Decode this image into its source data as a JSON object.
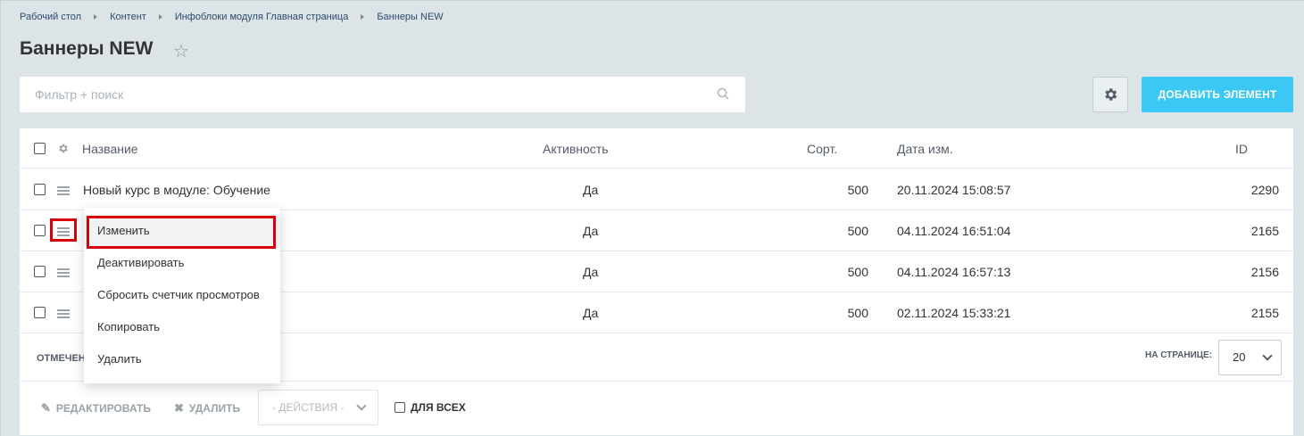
{
  "breadcrumb": [
    "Рабочий стол",
    "Контент",
    "Инфоблоки модуля Главная страница",
    "Баннеры NEW"
  ],
  "page": {
    "title": "Баннеры NEW"
  },
  "filter": {
    "placeholder": "Фильтр + поиск"
  },
  "toolbar": {
    "add_label": "ДОБАВИТЬ ЭЛЕМЕНТ"
  },
  "table": {
    "columns": {
      "name": "Название",
      "active": "Активность",
      "sort": "Сорт.",
      "date": "Дата изм.",
      "id": "ID"
    },
    "rows": [
      {
        "name": "Новый курс в модуле: Обучение",
        "active": "Да",
        "sort": "500",
        "date": "20.11.2024 15:08:57",
        "id": "2290"
      },
      {
        "name": "",
        "active": "Да",
        "sort": "500",
        "date": "04.11.2024 16:51:04",
        "id": "2165"
      },
      {
        "name": "",
        "active": "Да",
        "sort": "500",
        "date": "04.11.2024 16:57:13",
        "id": "2156"
      },
      {
        "name": "",
        "active": "Да",
        "sort": "500",
        "date": "02.11.2024 15:33:21",
        "id": "2155"
      }
    ]
  },
  "context_menu": {
    "items": [
      "Изменить",
      "Деактивировать",
      "Сбросить счетчик просмотров",
      "Копировать",
      "Удалить"
    ],
    "highlighted": "Изменить"
  },
  "footer": {
    "marked_label": "ОТМЕЧЕН",
    "per_page_label": "НА СТРАНИЦЕ:",
    "per_page_value": "20",
    "edit_label": "РЕДАКТИРОВАТЬ",
    "delete_label": "УДАЛИТЬ",
    "actions_value": "- ДЕЙСТВИЯ -",
    "for_all_label": "ДЛЯ ВСЕХ"
  },
  "colors": {
    "accent": "#3bc8f5",
    "link": "#2067b0",
    "highlight": "#d9000d"
  }
}
